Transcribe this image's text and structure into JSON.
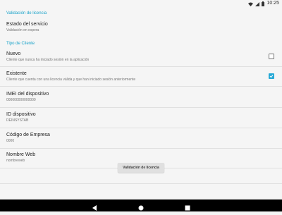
{
  "status_bar": {
    "time": "10:25",
    "icons": [
      "wifi-icon",
      "signal-icon",
      "battery-icon"
    ]
  },
  "sections": {
    "license": {
      "title": "Validación de licencia"
    },
    "client": {
      "title": "Tipo de Cliente"
    }
  },
  "prefs": {
    "service": {
      "title": "Estado del servicio",
      "summary": "Validación en espera"
    },
    "nuevo": {
      "title": "Nuevo",
      "summary": "Cliente que nunca ha iniciado sesión en la aplicación",
      "checked": false
    },
    "existente": {
      "title": "Existente",
      "summary": "Cliente que cuenta con una licencia válida y que han iniciado sesión anteriormente",
      "checked": true
    },
    "imei": {
      "title": "IMEI del dispositivo",
      "summary": "000000000000000"
    },
    "device_id": {
      "title": "ID dispositivo",
      "summary": "DEINSYSTAB"
    },
    "company": {
      "title": "Código de Empresa",
      "summary": "0000"
    },
    "web": {
      "title": "Nombre Web",
      "summary": "nombreweb"
    }
  },
  "button": {
    "label": "Validación de licencia"
  },
  "nav_bar": {
    "icons": [
      "back-icon",
      "home-icon",
      "recents-icon"
    ]
  },
  "colors": {
    "accent": "#1aa3c9",
    "checkbox": "#26a9d6"
  }
}
